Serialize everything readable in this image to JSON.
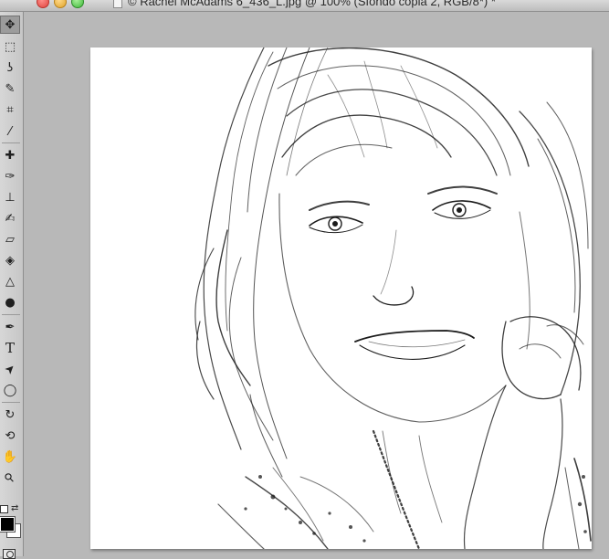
{
  "window": {
    "title": "© Rachel McAdams 6_436_L.jpg @ 100% (Sfondo copia 2, RGB/8*) *"
  },
  "tools": [
    {
      "name": "move-tool-icon",
      "glyph": "✥",
      "selected": true
    },
    {
      "name": "marquee-tool-icon",
      "glyph": "⬚"
    },
    {
      "name": "lasso-tool-icon",
      "glyph": "ʖ"
    },
    {
      "name": "quick-selection-tool-icon",
      "glyph": "✎"
    },
    {
      "name": "crop-tool-icon",
      "glyph": "⌗"
    },
    {
      "name": "eyedropper-tool-icon",
      "glyph": "⁄"
    },
    {
      "name": "healing-brush-tool-icon",
      "glyph": "✚"
    },
    {
      "name": "brush-tool-icon",
      "glyph": "✑"
    },
    {
      "name": "clone-stamp-tool-icon",
      "glyph": "⊥"
    },
    {
      "name": "history-brush-tool-icon",
      "glyph": "✍"
    },
    {
      "name": "eraser-tool-icon",
      "glyph": "▱"
    },
    {
      "name": "paint-bucket-tool-icon",
      "glyph": "◈"
    },
    {
      "name": "blur-tool-icon",
      "glyph": "△"
    },
    {
      "name": "dodge-tool-icon",
      "glyph": "●"
    },
    {
      "name": "pen-tool-icon",
      "glyph": "✒"
    },
    {
      "name": "type-tool-icon",
      "glyph": "T"
    },
    {
      "name": "path-selection-tool-icon",
      "glyph": "➤"
    },
    {
      "name": "ellipse-tool-icon",
      "glyph": "◯"
    },
    {
      "name": "3d-rotate-tool-icon",
      "glyph": "↻"
    },
    {
      "name": "3d-orbit-tool-icon",
      "glyph": "⟲"
    },
    {
      "name": "hand-tool-icon",
      "glyph": "✋"
    },
    {
      "name": "zoom-tool-icon",
      "glyph": "⚲"
    }
  ],
  "colors": {
    "foreground": "#000000",
    "background": "#ffffff"
  }
}
